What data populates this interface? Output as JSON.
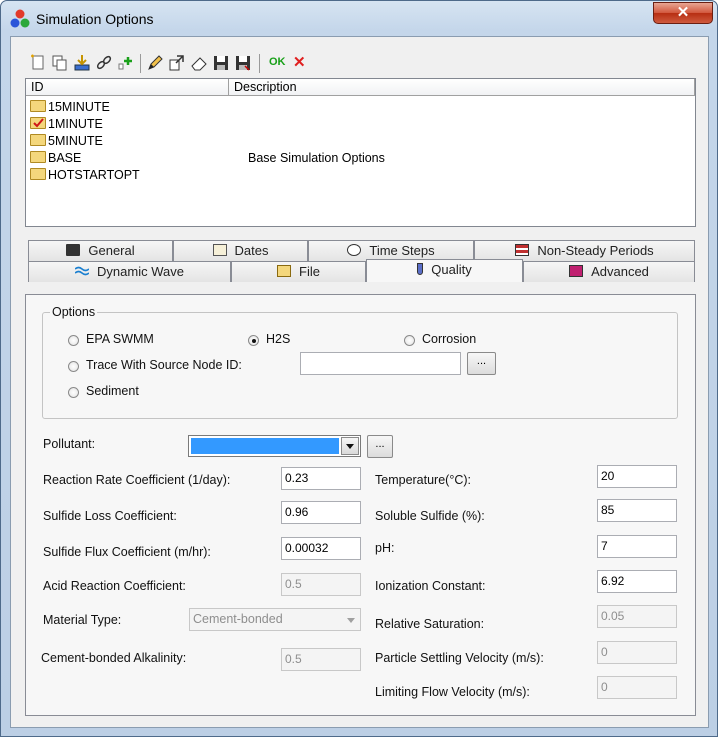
{
  "window": {
    "title": "Simulation Options",
    "close_glyph": "✕"
  },
  "toolbar": {
    "icons": [
      "new-icon",
      "copy-icon",
      "import-icon",
      "link-icon",
      "add-icon",
      "edit-icon",
      "open-icon",
      "erase-icon",
      "save-icon",
      "save-as-icon",
      "ok-icon",
      "cancel-icon"
    ],
    "ok_label": "OK",
    "cancel_label": "✕"
  },
  "list": {
    "columns": [
      "ID",
      "Description"
    ],
    "rows": [
      {
        "id": "15MINUTE",
        "description": "",
        "state": "folder"
      },
      {
        "id": "1MINUTE",
        "description": "",
        "state": "checked"
      },
      {
        "id": "5MINUTE",
        "description": "",
        "state": "folder"
      },
      {
        "id": "BASE",
        "description": "Base Simulation Options",
        "state": "folder"
      },
      {
        "id": "HOTSTARTOPT",
        "description": "",
        "state": "folder"
      }
    ]
  },
  "tabs": {
    "row1": [
      "General",
      "Dates",
      "Time Steps",
      "Non-Steady Periods"
    ],
    "row2": [
      "Dynamic Wave",
      "File",
      "Quality",
      "Advanced"
    ],
    "active": "Quality"
  },
  "quality": {
    "options_legend": "Options",
    "radio_epa": "EPA SWMM",
    "radio_h2s": "H2S",
    "radio_corrosion": "Corrosion",
    "radio_trace": "Trace With Source Node ID:",
    "radio_sediment": "Sediment",
    "selected": "H2S",
    "trace_value": "",
    "browse_label": "...",
    "pollutant_label": "Pollutant:",
    "pollutant_value": "",
    "left": [
      {
        "label": "Reaction Rate Coefficient (1/day):",
        "value": "0.23",
        "enabled": true
      },
      {
        "label": "Sulfide Loss Coefficient:",
        "value": "0.96",
        "enabled": true
      },
      {
        "label": "Sulfide Flux Coefficient (m/hr):",
        "value": "0.00032",
        "enabled": true
      },
      {
        "label": "Acid Reaction Coefficient:",
        "value": "0.5",
        "enabled": false
      }
    ],
    "material_label": "Material Type:",
    "material_value": "Cement-bonded",
    "alkalinity_label": "Cement-bonded Alkalinity:",
    "alkalinity_value": "0.5",
    "right": [
      {
        "label": "Temperature(°C):",
        "value": "20",
        "enabled": true
      },
      {
        "label": "Soluble Sulfide (%):",
        "value": "85",
        "enabled": true
      },
      {
        "label": "pH:",
        "value": "7",
        "enabled": true
      },
      {
        "label": "Ionization Constant:",
        "value": "6.92",
        "enabled": true
      },
      {
        "label": "Relative Saturation:",
        "value": "0.05",
        "enabled": false
      },
      {
        "label": "Particle Settling Velocity (m/s):",
        "value": "0",
        "enabled": false
      },
      {
        "label": "Limiting Flow Velocity (m/s):",
        "value": "0",
        "enabled": false
      }
    ]
  }
}
